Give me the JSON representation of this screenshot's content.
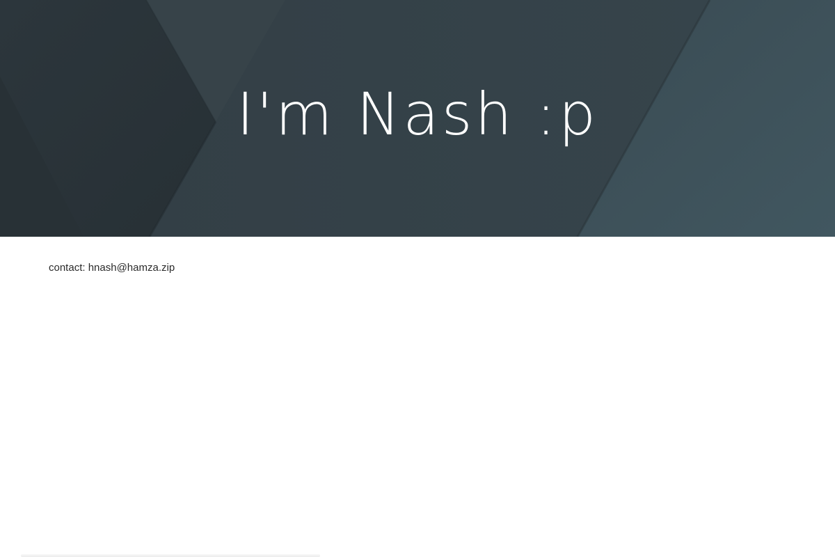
{
  "hero": {
    "title": "I'm Nash :p"
  },
  "content": {
    "contact_text": "contact: hnash@hamza.zip"
  },
  "colors": {
    "hero_dark": "#2b353b",
    "hero_mid": "#34424a",
    "hero_light": "#3d5058",
    "text": "#2a2a2a",
    "title": "#ffffff"
  }
}
